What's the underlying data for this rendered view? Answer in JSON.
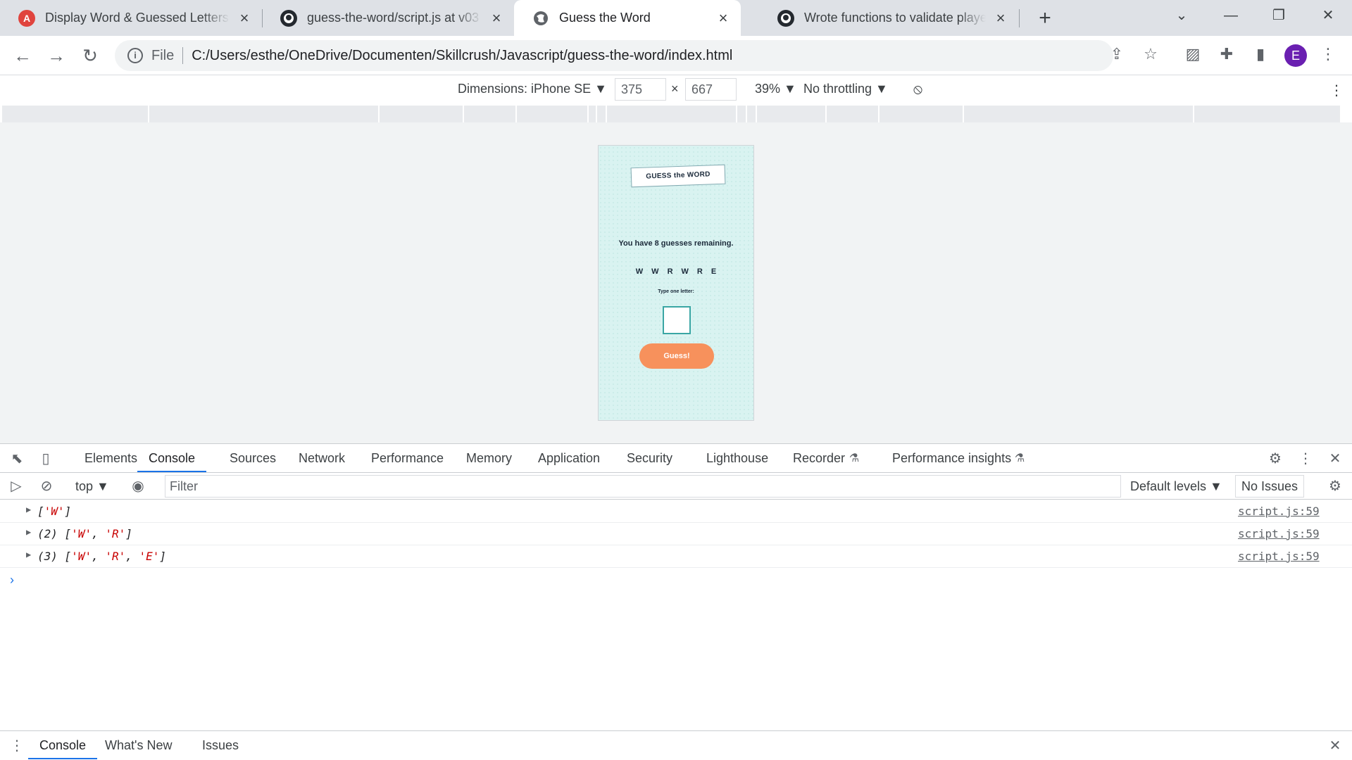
{
  "tabs": [
    {
      "title": "Display Word & Guessed Letters",
      "favicon": "acrobat-icon"
    },
    {
      "title": "guess-the-word/script.js at v03 ·",
      "favicon": "github-icon"
    },
    {
      "title": "Guess the Word",
      "favicon": "globe-icon",
      "active": true
    },
    {
      "title": "Wrote functions to validate player",
      "favicon": "github-icon"
    }
  ],
  "omnibox": {
    "scheme_label": "File",
    "url": "C:/Users/esthe/OneDrive/Documenten/Skillcrush/Javascript/guess-the-word/index.html"
  },
  "profile": {
    "initial": "E"
  },
  "device_toolbar": {
    "dimensions_label": "Dimensions: iPhone SE ▼",
    "width": "375",
    "times": "×",
    "height": "667",
    "zoom": "39% ▼",
    "throttling": "No throttling ▼"
  },
  "page": {
    "logo_text": "GUESS the WORD",
    "remaining": "You have 8 guesses remaining.",
    "word_letters": [
      "W",
      "W",
      "R",
      "W",
      "R",
      "E"
    ],
    "type_label": "Type one letter:",
    "guess_button": "Guess!"
  },
  "devtools": {
    "tabs": [
      "Elements",
      "Console",
      "Sources",
      "Network",
      "Performance",
      "Memory",
      "Application",
      "Security",
      "Lighthouse",
      "Recorder",
      "Performance insights"
    ],
    "context": "top ▼",
    "filter_placeholder": "Filter",
    "levels": "Default levels ▼",
    "issues": "No Issues",
    "logs": [
      {
        "count": "",
        "items": [
          "'W'"
        ],
        "source": "script.js:59"
      },
      {
        "count": "(2)",
        "items": [
          "'W'",
          "'R'"
        ],
        "source": "script.js:59"
      },
      {
        "count": "(3)",
        "items": [
          "'W'",
          "'R'",
          "'E'"
        ],
        "source": "script.js:59"
      }
    ],
    "drawer_tabs": [
      "Console",
      "What's New",
      "Issues"
    ]
  },
  "colors": {
    "accent": "#1a73e8",
    "guess_button": "#f7915c",
    "page_bg": "#d9f3f1"
  }
}
